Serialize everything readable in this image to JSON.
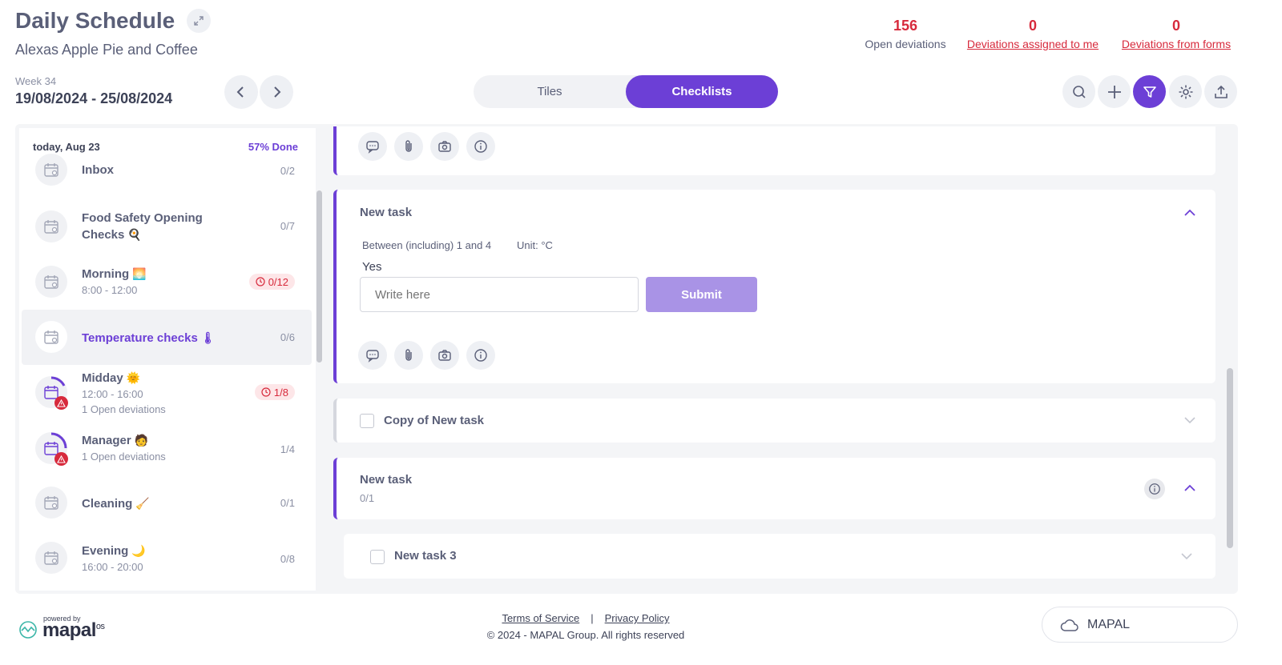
{
  "header": {
    "title": "Daily Schedule",
    "subtitle": "Alexas Apple Pie and Coffee",
    "stats": [
      {
        "value": "156",
        "label": "Open deviations"
      },
      {
        "value": "0",
        "label": "Deviations assigned to me"
      },
      {
        "value": "0",
        "label": "Deviations from forms"
      }
    ],
    "week_label": "Week 34",
    "week_range": "19/08/2024 - 25/08/2024",
    "view_toggle": {
      "tiles": "Tiles",
      "checklists": "Checklists",
      "active": "checklists"
    }
  },
  "sidebar": {
    "date": "today, Aug 23",
    "progress": "57% Done",
    "items": [
      {
        "name": "Inbox",
        "count": "0/2"
      },
      {
        "name_line1": "Food Safety Opening",
        "name_line2": "Checks",
        "emoji": "🍳",
        "count": "0/7"
      },
      {
        "name": "Morning",
        "emoji": "🌅",
        "time": "8:00 - 12:00",
        "badge": "0/12"
      },
      {
        "name": "Temperature checks",
        "emoji": "🌡",
        "count": "0/6",
        "active": true
      },
      {
        "name": "Midday",
        "emoji": "🌞",
        "time": "12:00 - 16:00",
        "deviations": "1 Open deviations",
        "badge": "1/8"
      },
      {
        "name": "Manager",
        "emoji": "🧑",
        "deviations": "1 Open deviations",
        "count": "1/4"
      },
      {
        "name": "Cleaning",
        "emoji": "🧹",
        "count": "0/1"
      },
      {
        "name": "Evening",
        "emoji": "🌙",
        "time": "16:00 - 20:00",
        "count": "0/8"
      }
    ]
  },
  "tasks": {
    "expanded": {
      "title": "New task",
      "range": "Between (including) 1 and 4",
      "unit": "Unit: °C",
      "answer": "Yes",
      "input_placeholder": "Write here",
      "submit_label": "Submit"
    },
    "copy": {
      "title": "Copy of New task"
    },
    "group": {
      "title": "New task",
      "count": "0/1"
    },
    "subtask": {
      "title": "New task 3"
    }
  },
  "footer": {
    "terms": "Terms of Service",
    "separator": "|",
    "privacy": "Privacy Policy",
    "copyright": "© 2024 - MAPAL Group. All rights reserved",
    "powered_by": "powered by",
    "logo": "mapal",
    "logo_suffix": "os",
    "brand_button": "MAPAL"
  },
  "colors": {
    "accent": "#6c3fd6",
    "danger": "#d72a3c",
    "submit_disabled": "#a993e6"
  }
}
